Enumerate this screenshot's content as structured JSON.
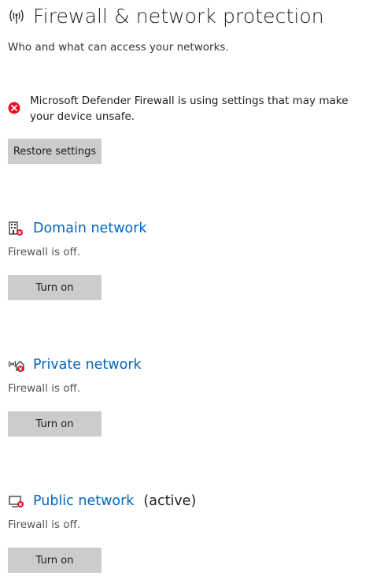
{
  "header": {
    "icon": "wifi-signal-icon",
    "title": "Firewall & network protection"
  },
  "subtitle": "Who and what can access your networks.",
  "warning": {
    "icon": "error-x-icon",
    "color": "#e81123",
    "text": "Microsoft Defender Firewall is using settings that may make your device unsafe."
  },
  "restore_button": "Restore settings",
  "networks": [
    {
      "icon": "domain-network-icon",
      "name": "Domain network",
      "active_label": "",
      "status": "Firewall is off.",
      "button": "Turn on"
    },
    {
      "icon": "private-network-icon",
      "name": "Private network",
      "active_label": "",
      "status": "Firewall is off.",
      "button": "Turn on"
    },
    {
      "icon": "public-network-icon",
      "name": "Public network",
      "active_label": "(active)",
      "status": "Firewall is off.",
      "button": "Turn on"
    }
  ],
  "colors": {
    "link": "#0067c0",
    "button_bg": "#cccccc",
    "error": "#e81123"
  }
}
